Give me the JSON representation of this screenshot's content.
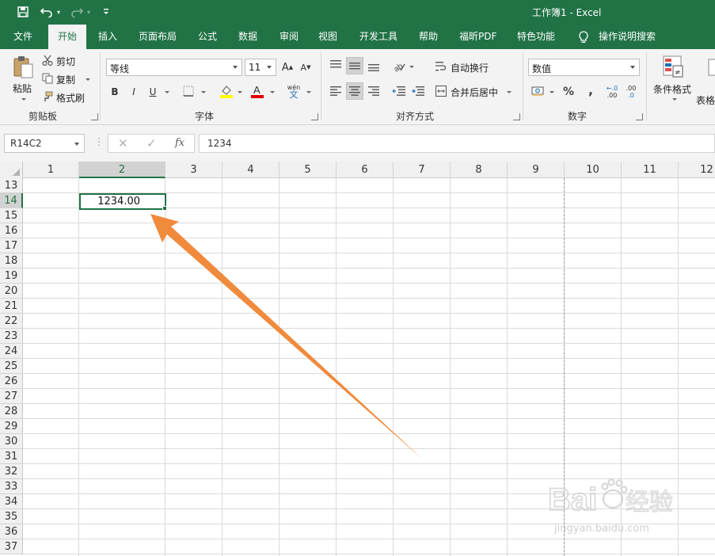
{
  "window": {
    "title": "工作簿1 - Excel"
  },
  "quick_access": {
    "save_icon": "save-icon",
    "undo_icon": "undo-icon",
    "redo_icon": "redo-icon",
    "customize_icon": "customize-icon"
  },
  "tabs": [
    {
      "label": "文件"
    },
    {
      "label": "开始"
    },
    {
      "label": "插入"
    },
    {
      "label": "页面布局"
    },
    {
      "label": "公式"
    },
    {
      "label": "数据"
    },
    {
      "label": "审阅"
    },
    {
      "label": "视图"
    },
    {
      "label": "开发工具"
    },
    {
      "label": "帮助"
    },
    {
      "label": "福昕PDF"
    },
    {
      "label": "特色功能"
    }
  ],
  "active_tab": "开始",
  "tell_me": {
    "label": "操作说明搜索"
  },
  "ribbon": {
    "clipboard": {
      "paste": "粘贴",
      "cut": "剪切",
      "copy": "复制",
      "format_painter": "格式刷",
      "group_label": "剪贴板"
    },
    "font": {
      "name": "等线",
      "size": "11",
      "bold": "B",
      "italic": "I",
      "underline": "U",
      "phonetic": "wén",
      "group_label": "字体"
    },
    "alignment": {
      "wrap_text": "自动换行",
      "merge_center": "合并后居中",
      "group_label": "对齐方式"
    },
    "number": {
      "format": "数值",
      "percent": "%",
      "comma": ",",
      "increase_decimal": ".00",
      "decrease_decimal": ".0",
      "group_label": "数字"
    },
    "styles": {
      "conditional_formatting": "条件格式",
      "table_format_partial": "表格"
    }
  },
  "formula_bar": {
    "name_box": "R14C2",
    "fx": "fx",
    "value": "1234"
  },
  "grid": {
    "columns": [
      "1",
      "2",
      "3",
      "4",
      "5",
      "6",
      "7",
      "8",
      "9",
      "10",
      "11",
      "12"
    ],
    "selected_column": "2",
    "rows": [
      "13",
      "14",
      "15",
      "16",
      "17",
      "18",
      "19",
      "20",
      "21",
      "22",
      "23",
      "24",
      "25",
      "26",
      "27",
      "28",
      "29",
      "30",
      "31",
      "32",
      "33",
      "34",
      "35",
      "36",
      "37"
    ],
    "selected_row": "14",
    "active_cell_value": "1234.00"
  },
  "annotation": {
    "arrow_color": "#f08a3c"
  },
  "watermark": {
    "brand": "Baidu经验",
    "domain": "jingyan.baidu.com"
  },
  "colors": {
    "excel_green": "#217346",
    "ribbon_bg": "#f3f3f3"
  }
}
